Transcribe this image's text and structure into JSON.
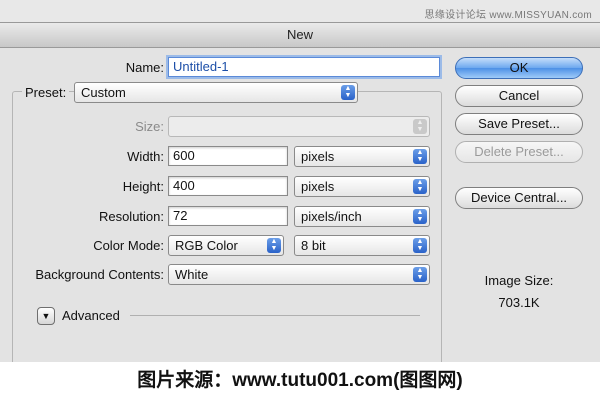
{
  "watermark": "思缘设计论坛 www.MISSYUAN.com",
  "dialog": {
    "title": "New",
    "name_label": "Name:",
    "name_value": "Untitled-1",
    "preset_label": "Preset:",
    "preset_value": "Custom",
    "size_label": "Size:",
    "size_value": "",
    "width_label": "Width:",
    "width_value": "600",
    "width_unit": "pixels",
    "height_label": "Height:",
    "height_value": "400",
    "height_unit": "pixels",
    "resolution_label": "Resolution:",
    "resolution_value": "72",
    "resolution_unit": "pixels/inch",
    "color_mode_label": "Color Mode:",
    "color_mode_value": "RGB Color",
    "bit_depth_value": "8 bit",
    "background_label": "Background Contents:",
    "background_value": "White",
    "advanced_label": "Advanced",
    "buttons": {
      "ok": "OK",
      "cancel": "Cancel",
      "save_preset": "Save Preset...",
      "delete_preset": "Delete Preset...",
      "device_central": "Device Central..."
    },
    "image_size_label": "Image Size:",
    "image_size_value": "703.1K"
  },
  "caption": "图片来源：www.tutu001.com(图图网)",
  "icons": {
    "popup_arrows": "updown-arrows-icon",
    "advanced_toggle": "disclosure-triangle-icon"
  }
}
